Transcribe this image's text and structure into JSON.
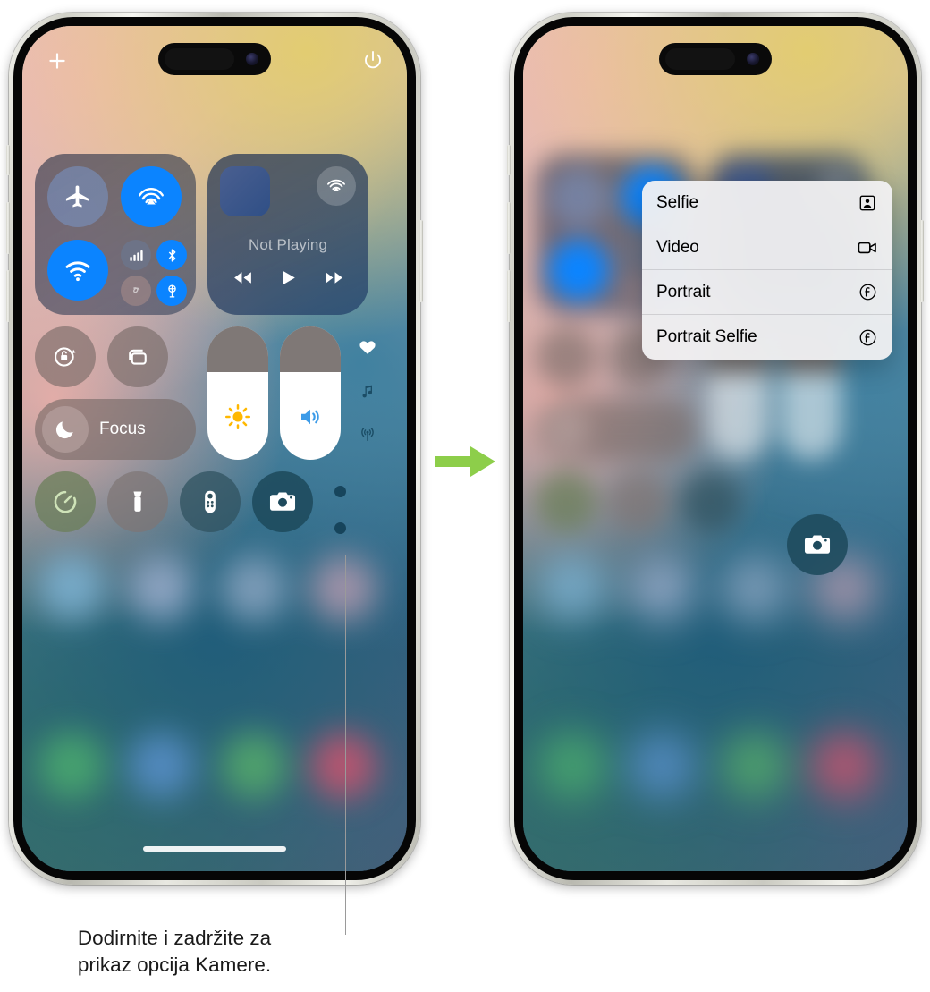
{
  "caption": {
    "line1": "Dodirnite i zadržite za",
    "line2": "prikaz opcija Kamere."
  },
  "colors": {
    "arrow_green": "#8DCE4A",
    "ios_blue": "#0B84FF",
    "callout_line": "#9A9A9A",
    "camera_tile": "#1E4A5C"
  },
  "phone_left": {
    "label": "Control Center",
    "top_bar": {
      "add_icon": "plus-icon",
      "power_icon": "power-icon"
    },
    "connectivity": {
      "airplane_mode": {
        "icon": "airplane-icon",
        "state": "off"
      },
      "airdrop": {
        "icon": "airdrop-icon",
        "state": "on"
      },
      "wifi": {
        "icon": "wifi-icon",
        "state": "on"
      },
      "cellular": {
        "icon": "cellular-bars-icon",
        "state": "off"
      },
      "bluetooth": {
        "icon": "bluetooth-icon",
        "state": "on"
      },
      "airdrop_small": {
        "icon": "airdrop-small-icon",
        "state": "off"
      },
      "hotspot": {
        "icon": "personal-hotspot-icon",
        "state": "on"
      }
    },
    "media": {
      "status": "Not Playing",
      "album_art": "album-art-placeholder",
      "airplay_icon": "airplay-audio-icon",
      "rewind_icon": "rewind-icon",
      "play_icon": "play-icon",
      "forward_icon": "fast-forward-icon"
    },
    "tiles": {
      "rotation_lock": "rotation-lock-icon",
      "screen_mirroring": "screen-mirroring-icon",
      "focus_label": "Focus",
      "focus_icon": "moon-icon"
    },
    "sliders": {
      "brightness": {
        "icon": "brightness-sun-icon",
        "value_pct": 66
      },
      "volume": {
        "icon": "volume-speaker-icon",
        "value_pct": 66
      }
    },
    "side_rail": [
      "heart-icon",
      "music-note-icon",
      "broadcast-icon"
    ],
    "shortcuts": {
      "timer": "timer-icon",
      "flashlight": "flashlight-icon",
      "remote": "apple-tv-remote-icon",
      "camera": "camera-icon"
    },
    "page_dots": 2,
    "home_indicator": "home-indicator"
  },
  "phone_right": {
    "label": "Control Center with Camera options menu",
    "context_menu": {
      "items": [
        {
          "label": "Selfie",
          "icon": "selfie-person-icon"
        },
        {
          "label": "Video",
          "icon": "video-camera-icon"
        },
        {
          "label": "Portrait",
          "icon": "portrait-f-icon"
        },
        {
          "label": "Portrait Selfie",
          "icon": "portrait-selfie-f-icon"
        }
      ]
    },
    "camera_tile_icon": "camera-icon"
  },
  "arrow": {
    "icon": "right-arrow-icon",
    "direction": "right"
  }
}
